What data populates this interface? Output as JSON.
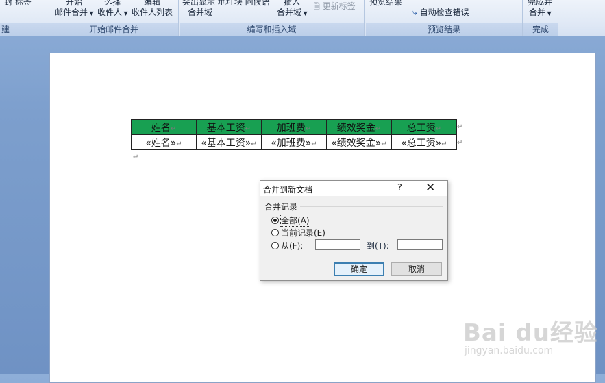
{
  "ribbon": {
    "groups": [
      {
        "label": "建"
      },
      {
        "label": "开始邮件合并"
      },
      {
        "label": "编写和插入域"
      },
      {
        "label": "预览结果"
      },
      {
        "label": "完成"
      }
    ],
    "g0": {
      "top_text": "封    标签"
    },
    "g1": {
      "top1": "开始",
      "top2": "选择",
      "top3": "编辑",
      "b1": "邮件合并",
      "b2": "收件人",
      "b3": "收件人列表"
    },
    "g2": {
      "top": "突出显示  地址块  问候语",
      "insert": "插入",
      "merge_fields": "合并域",
      "insert_field": "合并域",
      "update_labels": "更新标签"
    },
    "g3": {
      "preview": "预览结果",
      "auto_check": "自动检查错误"
    },
    "g4": {
      "finish_top": "完成并",
      "finish": "合并"
    }
  },
  "document": {
    "table": {
      "headers": [
        "姓名",
        "基本工资",
        "加班费",
        "绩效奖金",
        "总工资"
      ],
      "fields": [
        "«姓名»",
        "«基本工资»",
        "«加班费»",
        "«绩效奖金»",
        "«总工资»"
      ]
    },
    "cell_mark": "↵",
    "paragraph_mark": "↵"
  },
  "dialog": {
    "title": "合并到新文档",
    "help": "?",
    "close": "✕",
    "group_label": "合并记录",
    "option_all": "全部(A)",
    "option_current": "当前记录(E)",
    "option_from": "从(F):",
    "to_label": "到(T):",
    "from_value": "",
    "to_value": "",
    "ok": "确定",
    "cancel": "取消"
  },
  "watermark": {
    "brand": "Bai du经验",
    "url": "jingyan.baidu.com"
  }
}
